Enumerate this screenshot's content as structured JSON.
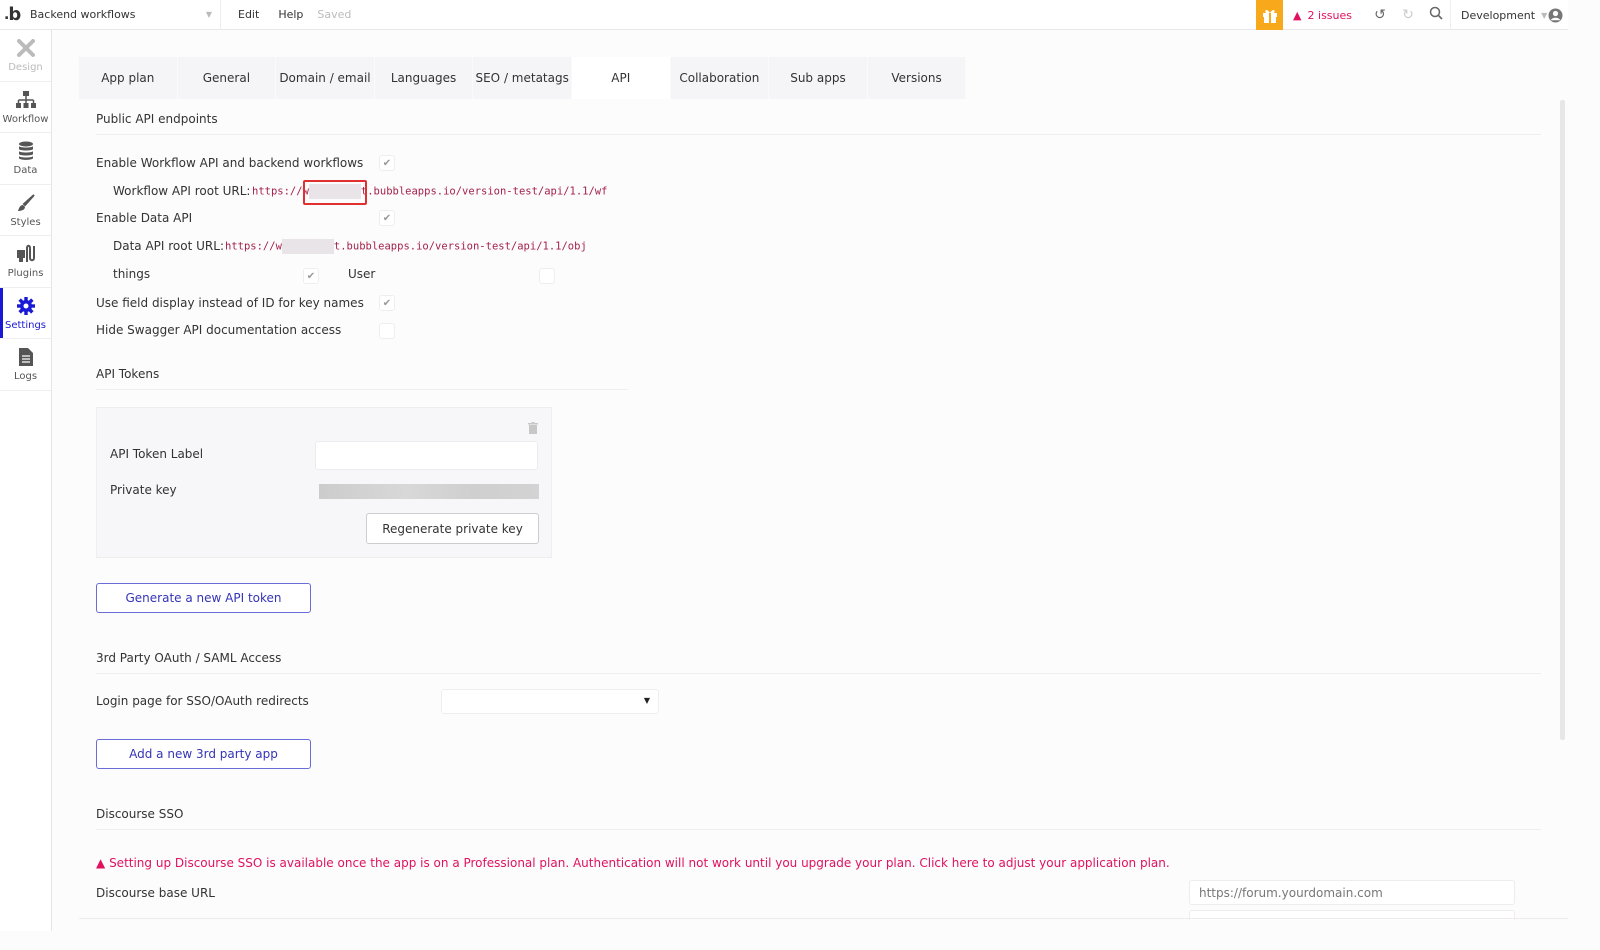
{
  "topbar": {
    "logo": "b",
    "page_name": "Backend workflows",
    "menu": [
      "Edit",
      "Help"
    ],
    "saved_status": "Saved",
    "issues_label": "2 issues",
    "environment": "Development",
    "colors": {
      "gift": "#f7a81b",
      "issues": "#e0115f"
    }
  },
  "sidebar": {
    "items": [
      {
        "label": "Design",
        "icon": "design-icon",
        "state": "disabled"
      },
      {
        "label": "Workflow",
        "icon": "workflow-icon",
        "state": "normal"
      },
      {
        "label": "Data",
        "icon": "database-icon",
        "state": "normal"
      },
      {
        "label": "Styles",
        "icon": "brush-icon",
        "state": "normal"
      },
      {
        "label": "Plugins",
        "icon": "plug-icon",
        "state": "normal"
      },
      {
        "label": "Settings",
        "icon": "gear-icon",
        "state": "active"
      },
      {
        "label": "Logs",
        "icon": "document-icon",
        "state": "normal"
      }
    ],
    "active_color": "#1a1ad6"
  },
  "tabs": [
    {
      "label": "App plan"
    },
    {
      "label": "General"
    },
    {
      "label": "Domain / email"
    },
    {
      "label": "Languages"
    },
    {
      "label": "SEO / metatags"
    },
    {
      "label": "API",
      "active": true
    },
    {
      "label": "Collaboration"
    },
    {
      "label": "Sub apps"
    },
    {
      "label": "Versions"
    }
  ],
  "public_api": {
    "title": "Public API endpoints",
    "enable_workflow_label": "Enable Workflow API and backend workflows",
    "enable_workflow_checked": true,
    "workflow_url_label": "Workflow API root URL:",
    "workflow_url_prefix": "https://w",
    "workflow_url_suffix": "t.bubbleapps.io/version-test/api/1.1/wf",
    "enable_data_label": "Enable Data API",
    "enable_data_checked": true,
    "data_url_label": "Data API root URL:",
    "data_url_prefix": "https://w",
    "data_url_suffix": "t.bubbleapps.io/version-test/api/1.1/obj",
    "types": [
      {
        "label": "things",
        "checked": true
      },
      {
        "label": "User",
        "checked": false
      }
    ],
    "field_display_label": "Use field display instead of ID for key names",
    "field_display_checked": true,
    "hide_swagger_label": "Hide Swagger API documentation access",
    "hide_swagger_checked": false
  },
  "api_tokens": {
    "title": "API Tokens",
    "token_label_label": "API Token Label",
    "token_label_value": "",
    "private_key_label": "Private key",
    "regenerate_label": "Regenerate private key",
    "generate_label": "Generate a new API token"
  },
  "oauth": {
    "title": "3rd Party OAuth / SAML Access",
    "login_page_label": "Login page for SSO/OAuth redirects",
    "login_page_value": "",
    "add_app_label": "Add a new 3rd party app"
  },
  "discourse": {
    "title": "Discourse SSO",
    "warning": "Setting up Discourse SSO is available once the app is on a Professional plan. Authentication will not work until you upgrade your plan. Click here to adjust your application plan.",
    "base_url_label": "Discourse base URL",
    "base_url_placeholder": "https://forum.yourdomain.com"
  }
}
